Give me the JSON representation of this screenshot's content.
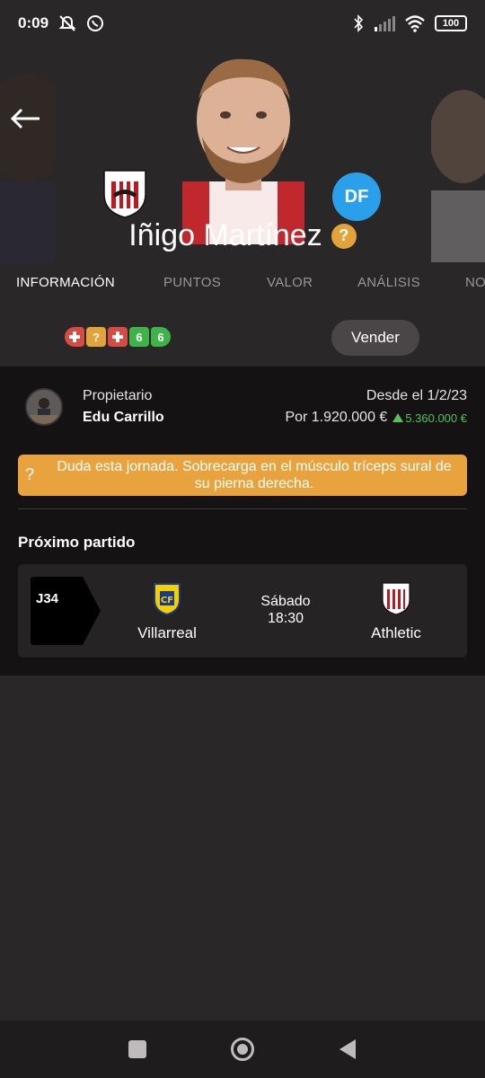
{
  "status_bar": {
    "time": "0:09",
    "battery": "100",
    "icons": [
      "mute-icon",
      "whatsapp-icon",
      "bluetooth-icon",
      "signal-icon",
      "wifi-icon",
      "battery-icon"
    ]
  },
  "player": {
    "name": "Iñigo Martínez",
    "position": "DF",
    "club": "Athletic Club"
  },
  "tabs": [
    {
      "label": "INFORMACIÓN",
      "active": true
    },
    {
      "label": "PUNTOS",
      "active": false
    },
    {
      "label": "VALOR",
      "active": false
    },
    {
      "label": "ANÁLISIS",
      "active": false
    },
    {
      "label": "NO",
      "active": false
    }
  ],
  "recent_status": [
    {
      "type": "injury",
      "color": "#d94a43"
    },
    {
      "type": "doubt",
      "text": "?",
      "color": "#e3a33b"
    },
    {
      "type": "injury",
      "color": "#d94a43"
    },
    {
      "type": "points",
      "text": "6",
      "color": "#3db34a"
    },
    {
      "type": "points",
      "text": "6",
      "color": "#3db34a"
    }
  ],
  "sell_button": "Vender",
  "owner": {
    "label": "Propietario",
    "name": "Edu Carrillo",
    "since": "Desde el 1/2/23",
    "price": "Por 1.920.000 €",
    "gain": "5.360.000 €"
  },
  "alert": {
    "icon": "?",
    "text": "Duda esta jornada. Sobrecarga en el músculo tríceps sural de su pierna derecha."
  },
  "next_match": {
    "title": "Próximo partido",
    "round": "J34",
    "home_team": "Villarreal",
    "away_team": "Athletic",
    "day": "Sábado",
    "time": "18:30"
  },
  "colors": {
    "background": "#2a2728",
    "panel": "#141213",
    "accent_orange": "#e8a33e",
    "position_blue": "#2aa0ea",
    "gain_green": "#53c258"
  }
}
